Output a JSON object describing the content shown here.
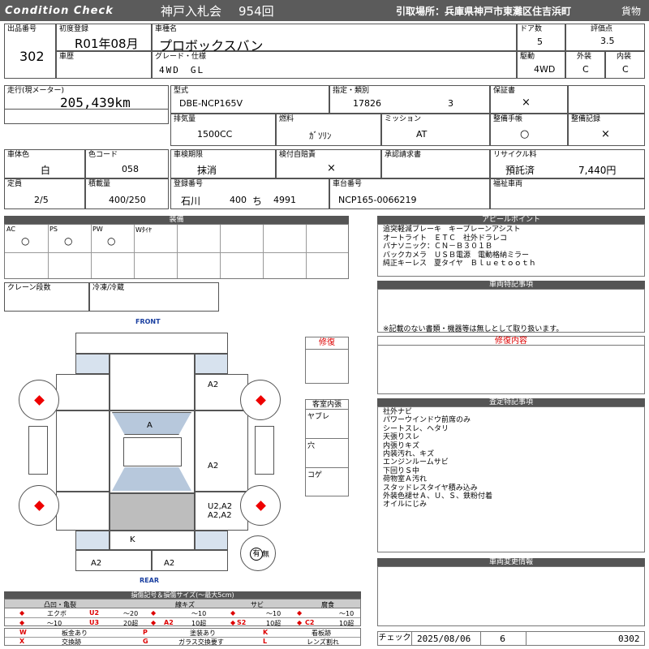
{
  "header": {
    "title": "Condition Check",
    "auction": "神戸入札会",
    "lot": "954回",
    "pickup": "引取場所：兵庫県神戸市東灘区住吉浜町",
    "category": "貨物"
  },
  "row1": {
    "lot_no_label": "出品番号",
    "lot_no": "302",
    "first_reg_label": "初度登録",
    "first_reg": "R01年08月",
    "car_name_label": "車種名",
    "car_name": "プロボックスバン",
    "doors_label": "ドア数",
    "doors": "5",
    "score_label": "評価点",
    "score": "3.5",
    "history_label": "車歴",
    "grade_label": "グレード・仕様",
    "grade": "4WD　GL",
    "drive_label": "駆動",
    "drive": "4WD",
    "ext_label": "外装",
    "ext": "C",
    "int_label": "内装",
    "int": "C"
  },
  "row2": {
    "mileage_label": "走行(現メーター)",
    "mileage": "205,439km",
    "model_label": "型式",
    "model": "DBE-NCP165V",
    "designation_label": "指定・類別",
    "designation": "17826",
    "class_no": "3",
    "warranty_label": "保証書",
    "warranty": "×",
    "displacement_label": "排気量",
    "displacement": "1500CC",
    "fuel_label": "燃料",
    "fuel": "ｶﾞｿﾘﾝ",
    "mission_label": "ミッション",
    "mission": "AT",
    "manual_label": "整備手帳",
    "manual": "○",
    "service_label": "整備記録",
    "service": "×"
  },
  "row3": {
    "body_color_label": "車体色",
    "body_color": "白",
    "color_code_label": "色コード",
    "color_code": "058",
    "inspection_label": "車検期限",
    "inspection": "抹消",
    "self_inspection_label": "検付自賠責",
    "self_inspection": "×",
    "approval_label": "承認請求書",
    "recycle_label": "リサイクル料",
    "recycle_status": "預託済",
    "recycle_fee": "7,440円",
    "capacity_label": "定員",
    "capacity": "2/5",
    "load_label": "積載量",
    "load": "400/250",
    "reg_no_label": "登録番号",
    "reg_pref": "石川",
    "reg_class": "400",
    "reg_kana": "ち",
    "reg_num": "4991",
    "chassis_label": "車台番号",
    "chassis": "NCP165-0066219",
    "welfare_label": "福祉車両"
  },
  "equipment": {
    "title": "装備",
    "items": [
      {
        "label": "AC",
        "mark": "○"
      },
      {
        "label": "PS",
        "mark": "○"
      },
      {
        "label": "PW",
        "mark": "○"
      },
      {
        "label": "Wﾀｲﾔ",
        "mark": ""
      }
    ],
    "crane_label": "クレーン段数",
    "fridge_label": "冷凍/冷蔵"
  },
  "appeal": {
    "title": "アピールポイント",
    "lines": [
      "追突軽減ブレーキ　キープレーンアシスト",
      "オートライト　ＥＴＣ　社外ドラレコ",
      "パナソニック：ＣＮ－Ｂ３０１Ｂ",
      "バックカメラ　ＵＳＢ電源　電動格納ミラー",
      "純正キーレス　夏タイヤ　Ｂｌｕｅｔｏｏｔｈ"
    ]
  },
  "special": {
    "title": "車両特記事項",
    "note": "※記載のない書類・機器等は無しとして取り扱います。"
  },
  "repair_content": {
    "title": "修復内容"
  },
  "inspection_notes": {
    "title": "査定特記事項",
    "lines": [
      "社外ナビ",
      "パワーウインドウ前席のみ",
      "シートスレ、ヘタリ",
      "天張りスレ",
      "内張りキズ",
      "内装汚れ、キズ",
      "エンジンルームサビ",
      "下回りＳ中",
      "荷物室Ａ汚れ",
      "スタッドレスタイヤ積み込み",
      "外装色褪せＡ、Ｕ、Ｓ、鉄粉付着",
      "オイルにじみ"
    ]
  },
  "change_info": {
    "title": "車両変更情報"
  },
  "diagram": {
    "front": "FRONT",
    "rear": "REAR",
    "marks": {
      "right_front": "A2",
      "roof": "A",
      "right_mid": "A2",
      "right_rear": "U2,A2\nA2,A2",
      "rear_gate": "K",
      "rear_left": "A2",
      "rear_right": "A2"
    },
    "spare": "有",
    "spare_none": "無",
    "repair_label": "修復",
    "cabin_title": "客室内張",
    "cabin_rows": [
      "ヤブレ",
      "穴",
      "コゲ"
    ]
  },
  "legend": {
    "title": "損傷記号＆損傷サイズ(～最大5cm)",
    "groups": [
      {
        "name": "凸凹・亀裂",
        "rows": [
          [
            "◆",
            "エクボ",
            "U2",
            "～20"
          ],
          [
            "◆",
            "～10",
            "U3",
            "20超"
          ]
        ]
      },
      {
        "name": "線キズ",
        "rows": [
          [
            "◆",
            "～10",
            "A2",
            "10超"
          ],
          [
            "◆",
            "",
            "",
            ""
          ]
        ]
      },
      {
        "name": "サビ",
        "rows": [
          [
            "◆",
            "～10",
            "S2",
            "10超"
          ],
          [
            "◆",
            "",
            "",
            ""
          ]
        ]
      },
      {
        "name": "腐食",
        "rows": [
          [
            "◆",
            "～10",
            "C2",
            "10超"
          ],
          [
            "◆",
            "",
            "",
            ""
          ]
        ]
      }
    ],
    "codes": [
      [
        "W",
        "板金あり",
        "P",
        "塗装あり",
        "K",
        "看板跡"
      ],
      [
        "X",
        "交換跡",
        "G",
        "ガラス交換要す",
        "L",
        "レンズ割れ"
      ]
    ]
  },
  "footer": {
    "check_label": "チェック",
    "date": "2025/08/06",
    "count": "6",
    "code": "0302"
  },
  "colors": {
    "header_bg": "#5b5b5b",
    "accent_red": "#d00000",
    "panel_blue": "#d7e2ee"
  }
}
